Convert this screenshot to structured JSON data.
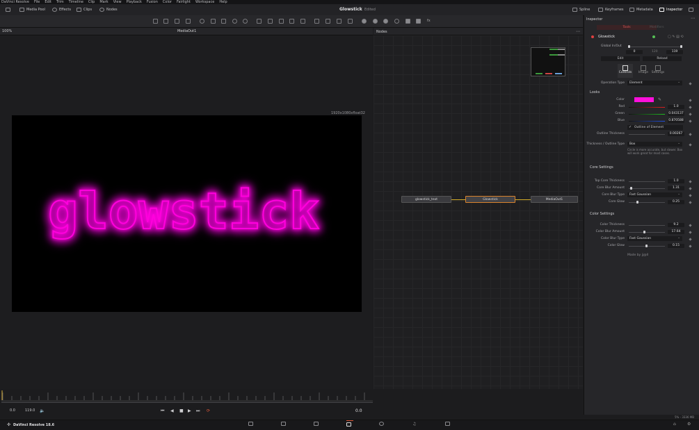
{
  "menubar": [
    "DaVinci Resolve",
    "File",
    "Edit",
    "Trim",
    "Timeline",
    "Clip",
    "Mark",
    "View",
    "Playback",
    "Fusion",
    "Color",
    "Fairlight",
    "Workspace",
    "Help"
  ],
  "toolbar": {
    "media_pool": "Media Pool",
    "effects": "Effects",
    "clips": "Clips",
    "nodes": "Nodes",
    "spline": "Spline",
    "keyframes": "Keyframes",
    "metadata": "Metadata",
    "inspector": "Inspector"
  },
  "project": {
    "title": "Glowstick",
    "status": "Edited"
  },
  "viewer": {
    "zoom": "100%",
    "name": "MediaOut1",
    "resolution": "1920x1080xfloat32",
    "canvas_text": "glowstick",
    "glow_color": "#ff00dd"
  },
  "timeline": {
    "start": "0.0",
    "end": "119.0",
    "current": "0.0"
  },
  "nodes": {
    "title": "Nodes",
    "items": [
      {
        "label": "glowstick_text"
      },
      {
        "label": "Glowstick"
      },
      {
        "label": "MediaOut1"
      }
    ]
  },
  "inspector": {
    "title": "Inspector",
    "tab_tools": "Tools",
    "tab_modifiers": "Modifiers",
    "node_name": "Glowstick",
    "global_inout_label": "Global In/Out",
    "global_in": "0",
    "global_mid": "120",
    "global_out": "119",
    "edit_btn": "Edit",
    "reload_btn": "Reload",
    "subtabs": [
      "Controls",
      "Image",
      "Settings"
    ],
    "operation_type_label": "Operation Type",
    "operation_type": "Element",
    "looks_section": "Looks",
    "color_label": "Color",
    "color_swatch": "#ff10dc",
    "red_label": "Red",
    "red": "1.0",
    "green_label": "Green",
    "green": "0.043137",
    "blue_label": "Blue",
    "blue": "0.870588",
    "outline_check": "Outline of Element",
    "outline_thickness_label": "Outline Thickness",
    "outline_thickness": "0.00267",
    "thickness_type_label": "Thickness / Outline Type",
    "thickness_type": "Box",
    "hint": "Circle is more accurate, but slower. Box will work great for most cases.",
    "core_section": "Core Settings",
    "top_core_label": "Top Core Thickness",
    "top_core": "1.0",
    "core_blur_amount_label": "Core Blur Amount",
    "core_blur_amount": "1.31",
    "core_blur_type_label": "Core Blur Type",
    "core_blur_type": "Fast Gaussian",
    "core_glow_label": "Core Glow",
    "core_glow": "0.25",
    "color_section": "Color Settings",
    "color_thickness_label": "Color Thickness",
    "color_thickness": "9.2",
    "color_blur_amount_label": "Color Blur Amount",
    "color_blur_amount": "17.64",
    "color_blur_type_label": "Color Blur Type",
    "color_blur_type": "Fast Gaussian",
    "color_glow_label": "Color Glow",
    "color_glow": "0.15",
    "credit": "Made by jj@ll"
  },
  "status": {
    "app": "DaVinci Resolve 18.6",
    "memory": "5% - 3336 MB"
  }
}
